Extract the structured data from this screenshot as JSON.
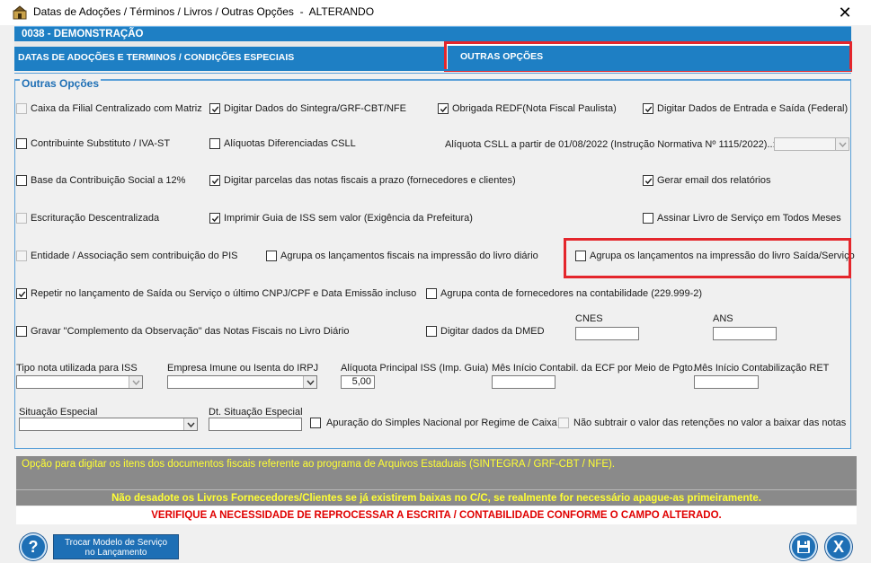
{
  "window": {
    "title": "Datas de Adoções / Términos / Livros / Outras Opções  -  ALTERANDO",
    "close_label": "✕"
  },
  "company_bar": "0038  -  DEMONSTRAÇÃO",
  "tabs": [
    {
      "label": "DATAS DE ADOÇÕES E TERMINOS / CONDIÇÕES ESPECIAIS",
      "selected": false
    },
    {
      "label": "OUTRAS OPÇÕES",
      "selected": true
    }
  ],
  "group_title": "Outras Opções",
  "checkboxes": {
    "caixa_filial": {
      "label": "Caixa da Filial Centralizado com Matriz",
      "checked": false,
      "enabled": false
    },
    "sintegra": {
      "label": "Digitar Dados do Sintegra/GRF-CBT/NFE",
      "checked": true,
      "enabled": true
    },
    "redf": {
      "label": "Obrigada REDF(Nota Fiscal Paulista)",
      "checked": true,
      "enabled": true
    },
    "entrada_saida": {
      "label": "Digitar Dados de Entrada e Saída (Federal)",
      "checked": true,
      "enabled": true
    },
    "substituto": {
      "label": "Contribuinte Substituto / IVA-ST",
      "checked": false,
      "enabled": true
    },
    "aliquotas_csll": {
      "label": "Alíquotas Diferenciadas CSLL",
      "checked": false,
      "enabled": true
    },
    "base_contrib": {
      "label": "Base da Contribuição Social a 12%",
      "checked": false,
      "enabled": true
    },
    "parcelas": {
      "label": "Digitar parcelas das notas fiscais a prazo (fornecedores e clientes)",
      "checked": true,
      "enabled": true
    },
    "gerar_email": {
      "label": "Gerar email dos relatórios",
      "checked": true,
      "enabled": true
    },
    "escrit_desc": {
      "label": "Escrituração Descentralizada",
      "checked": false,
      "enabled": false
    },
    "guia_iss": {
      "label": "Imprimir Guia de ISS sem valor (Exigência da Prefeitura)",
      "checked": true,
      "enabled": true
    },
    "assinar_livro": {
      "label": "Assinar Livro de Serviço em Todos Meses",
      "checked": false,
      "enabled": true
    },
    "entidade": {
      "label": "Entidade / Associação sem contribuição do PIS",
      "checked": false,
      "enabled": false
    },
    "agrupa_diario": {
      "label": "Agrupa os lançamentos fiscais na impressão do livro diário",
      "checked": false,
      "enabled": true
    },
    "agrupa_saida": {
      "label": "Agrupa os lançamentos na impressão do livro Saída/Serviço",
      "checked": false,
      "enabled": true
    },
    "repetir": {
      "label": "Repetir no lançamento de Saída ou Serviço o último CNPJ/CPF e Data Emissão incluso",
      "checked": true,
      "enabled": true
    },
    "agrupa_fornec": {
      "label": "Agrupa conta de fornecedores na contabilidade (229.999-2)",
      "checked": false,
      "enabled": true
    },
    "gravar_compl": {
      "label": "Gravar \"Complemento da Observação\" das Notas Fiscais no Livro Diário",
      "checked": false,
      "enabled": true
    },
    "dmed": {
      "label": "Digitar dados da DMED",
      "checked": false,
      "enabled": true
    },
    "simples": {
      "label": "Apuração do Simples Nacional por Regime de Caixa",
      "checked": false,
      "enabled": true
    },
    "nao_subtrair": {
      "label": "Não subtrair o valor das retenções no valor a baixar das notas",
      "checked": false,
      "enabled": false
    }
  },
  "labels": {
    "aliquota_csll_text": "Alíquota CSLL a partir de 01/08/2022 (Instrução Normativa Nº 1115/2022)..:",
    "cnes": "CNES",
    "ans": "ANS",
    "tipo_nota": "Tipo nota utilizada para ISS",
    "empresa_imune": "Empresa Imune ou Isenta do IRPJ",
    "aliquota_iss": "Alíquota Principal ISS (Imp. Guia)",
    "mes_ecf": "Mês Início Contabil. da ECF por Meio de Pgto.",
    "mes_ret": "Mês Início Contabilização RET",
    "situacao": "Situação Especial",
    "dt_situacao": "Dt. Situação Especial"
  },
  "fields": {
    "aliquota_iss_value": "5,00",
    "cnes_value": "",
    "ans_value": "",
    "mes_ecf_value": "",
    "mes_ret_value": "",
    "dt_situacao_value": ""
  },
  "info": {
    "line1": "Opção para digitar os itens dos documentos fiscais referente ao programa de Arquivos Estaduais (SINTEGRA / GRF-CBT / NFE).",
    "line2": "Não desadote os Livros Fornecedores/Clientes se já existirem baixas no C/C, se realmente for necessário apague-as primeiramente.",
    "line3": "VERIFIQUE A NECESSIDADE DE REPROCESSAR A ESCRITA / CONTABILIDADE CONFORME O CAMPO ALTERADO."
  },
  "buttons": {
    "help": "?",
    "service_line1": "Trocar Modelo de Serviço",
    "service_line2": "no Lançamento",
    "close": "X"
  },
  "colors": {
    "accent": "#1e7fc4",
    "highlight": "#e4262c",
    "warning_text": "#ffff33",
    "alert_text": "#e00000"
  }
}
